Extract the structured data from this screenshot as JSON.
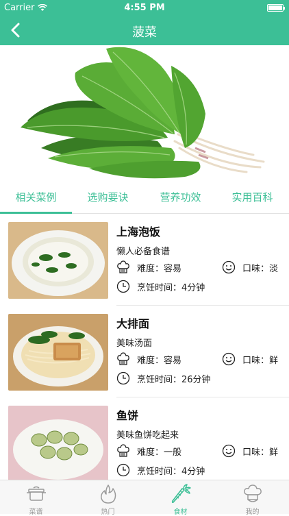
{
  "status": {
    "carrier": "Carrier",
    "time": "4:55 PM"
  },
  "nav": {
    "title": "菠菜"
  },
  "tabs": [
    "相关菜例",
    "选购要诀",
    "营养功效",
    "实用百科"
  ],
  "recipes": [
    {
      "name": "上海泡饭",
      "desc": "懒人必备食谱",
      "difficulty": "难度：容易",
      "taste": "口味：淡",
      "time": "烹饪时间：4分钟"
    },
    {
      "name": "大排面",
      "desc": "美味汤面",
      "difficulty": "难度：容易",
      "taste": "口味：鲜",
      "time": "烹饪时间：26分钟"
    },
    {
      "name": "鱼饼",
      "desc": "美味鱼饼吃起来",
      "difficulty": "难度：一般",
      "taste": "口味：鲜",
      "time": "烹饪时间：4分钟"
    }
  ],
  "tabbar": [
    {
      "label": "菜谱",
      "icon": "pot-icon"
    },
    {
      "label": "热门",
      "icon": "flame-icon"
    },
    {
      "label": "食材",
      "icon": "carrot-icon"
    },
    {
      "label": "我的",
      "icon": "chef-hat-icon"
    }
  ],
  "colors": {
    "accent": "#3cbf96",
    "inactive": "#999999"
  }
}
